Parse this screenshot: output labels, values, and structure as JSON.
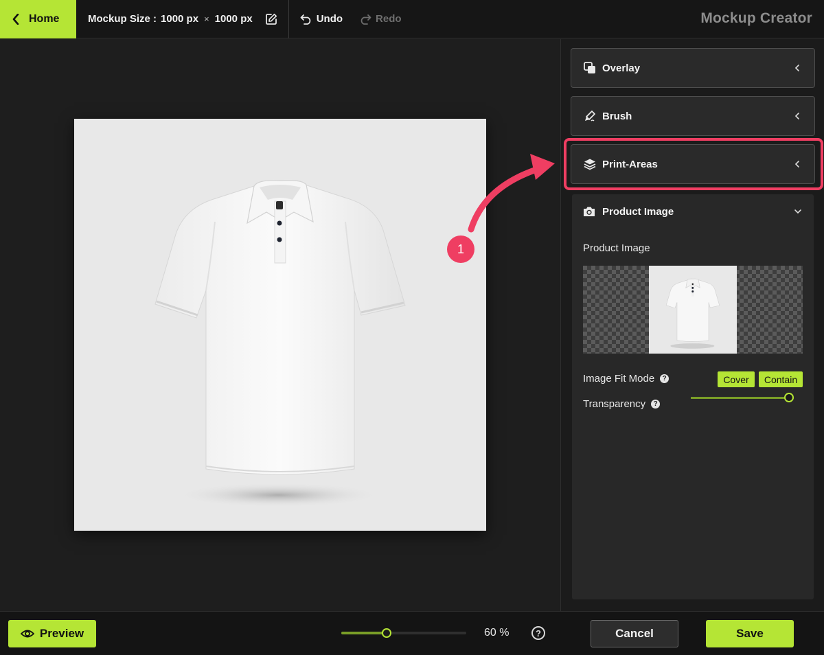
{
  "header": {
    "home_label": "Home",
    "mockup_size_label": "Mockup Size :",
    "width": "1000 px",
    "times": "×",
    "height": "1000 px",
    "undo_label": "Undo",
    "redo_label": "Redo",
    "app_title": "Mockup Creator"
  },
  "panel": {
    "sections": {
      "overlay": "Overlay",
      "brush": "Brush",
      "print_areas": "Print-Areas",
      "product_image": "Product Image"
    },
    "product_image": {
      "label": "Product Image",
      "fit_mode_label": "Image Fit Mode",
      "fit_options": [
        "Cover",
        "Contain"
      ],
      "transparency_label": "Transparency",
      "transparency_value": 1.0,
      "help_glyph": "?"
    }
  },
  "annotation": {
    "step": "1",
    "color": "#ef3e62"
  },
  "footer": {
    "preview_label": "Preview",
    "zoom_value": 0.35,
    "zoom_label": "60 %",
    "help_glyph": "?",
    "cancel_label": "Cancel",
    "save_label": "Save"
  },
  "colors": {
    "accent": "#b5e535",
    "background": "#1e1e1e",
    "panel": "#282828",
    "highlight": "#ef3e62"
  },
  "icons": [
    "chevron-left-icon",
    "edit-icon",
    "undo-icon",
    "redo-icon",
    "overlay-icon",
    "brush-icon",
    "layers-icon",
    "camera-icon",
    "chevron-down-icon",
    "eye-icon",
    "help-icon"
  ]
}
